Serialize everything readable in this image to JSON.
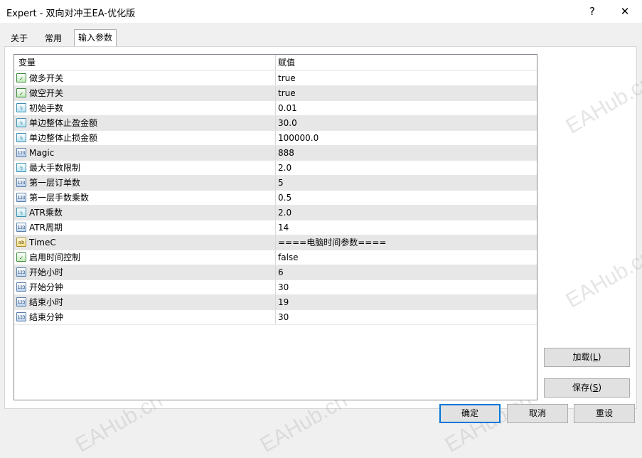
{
  "window": {
    "title": "Expert - 双向对冲王EA-优化版",
    "help_glyph": "?",
    "close_glyph": "✕"
  },
  "tabs": [
    "关于",
    "常用",
    "输入参数"
  ],
  "grid": {
    "headers": {
      "name": "变量",
      "value": "赋值"
    },
    "rows": [
      {
        "type": "bool",
        "icon": "bool-icon",
        "name": "做多开关",
        "value": "true"
      },
      {
        "type": "bool",
        "icon": "bool-icon",
        "name": "做空开关",
        "value": "true"
      },
      {
        "type": "double",
        "icon": "double-icon",
        "name": "初始手数",
        "value": "0.01"
      },
      {
        "type": "double",
        "icon": "double-icon",
        "name": "单边整体止盈金额",
        "value": "30.0"
      },
      {
        "type": "double",
        "icon": "double-icon",
        "name": "单边整体止损金额",
        "value": "100000.0"
      },
      {
        "type": "int",
        "icon": "int-icon",
        "name": "Magic",
        "value": "888"
      },
      {
        "type": "double",
        "icon": "double-icon",
        "name": "最大手数限制",
        "value": "2.0"
      },
      {
        "type": "int",
        "icon": "int-icon",
        "name": "第一层订单数",
        "value": "5"
      },
      {
        "type": "int",
        "icon": "int-icon",
        "name": "第一层手数乘数",
        "value": "0.5"
      },
      {
        "type": "double",
        "icon": "double-icon",
        "name": "ATR乘数",
        "value": "2.0"
      },
      {
        "type": "int",
        "icon": "int-icon",
        "name": "ATR周期",
        "value": "14"
      },
      {
        "type": "string",
        "icon": "string-icon",
        "name": "TimeC",
        "value": "====电脑时间参数===="
      },
      {
        "type": "bool",
        "icon": "bool-icon",
        "name": "启用时间控制",
        "value": "false"
      },
      {
        "type": "int",
        "icon": "int-icon",
        "name": "开始小时",
        "value": "6"
      },
      {
        "type": "int",
        "icon": "int-icon",
        "name": "开始分钟",
        "value": "30"
      },
      {
        "type": "int",
        "icon": "int-icon",
        "name": "结束小时",
        "value": "19"
      },
      {
        "type": "int",
        "icon": "int-icon",
        "name": "结束分钟",
        "value": "30"
      }
    ]
  },
  "icon_glyphs": {
    "bool": "✓",
    "double": "½",
    "int": "123",
    "string": "ab"
  },
  "buttons": {
    "load": {
      "label": "加载(",
      "key": "L",
      "tail": ")"
    },
    "save": {
      "label": "保存(",
      "key": "S",
      "tail": ")"
    },
    "ok": "确定",
    "cancel": "取消",
    "reset": "重设"
  },
  "watermark": "EAHub.cn",
  "colors": {
    "focus_border": "#0078d7",
    "row_alt": "#e7e7e7"
  }
}
